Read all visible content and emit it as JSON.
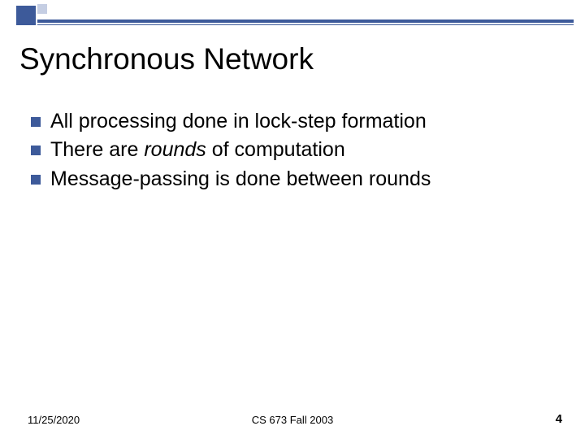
{
  "title": "Synchronous Network",
  "bullets": [
    {
      "prefix": "All processing done in lock-step formation"
    },
    {
      "prefix": "There are ",
      "em": "rounds",
      "suffix": " of computation"
    },
    {
      "prefix": "Message-passing is done between rounds"
    }
  ],
  "footer": {
    "date": "11/25/2020",
    "course": "CS 673 Fall 2003",
    "page": "4"
  }
}
